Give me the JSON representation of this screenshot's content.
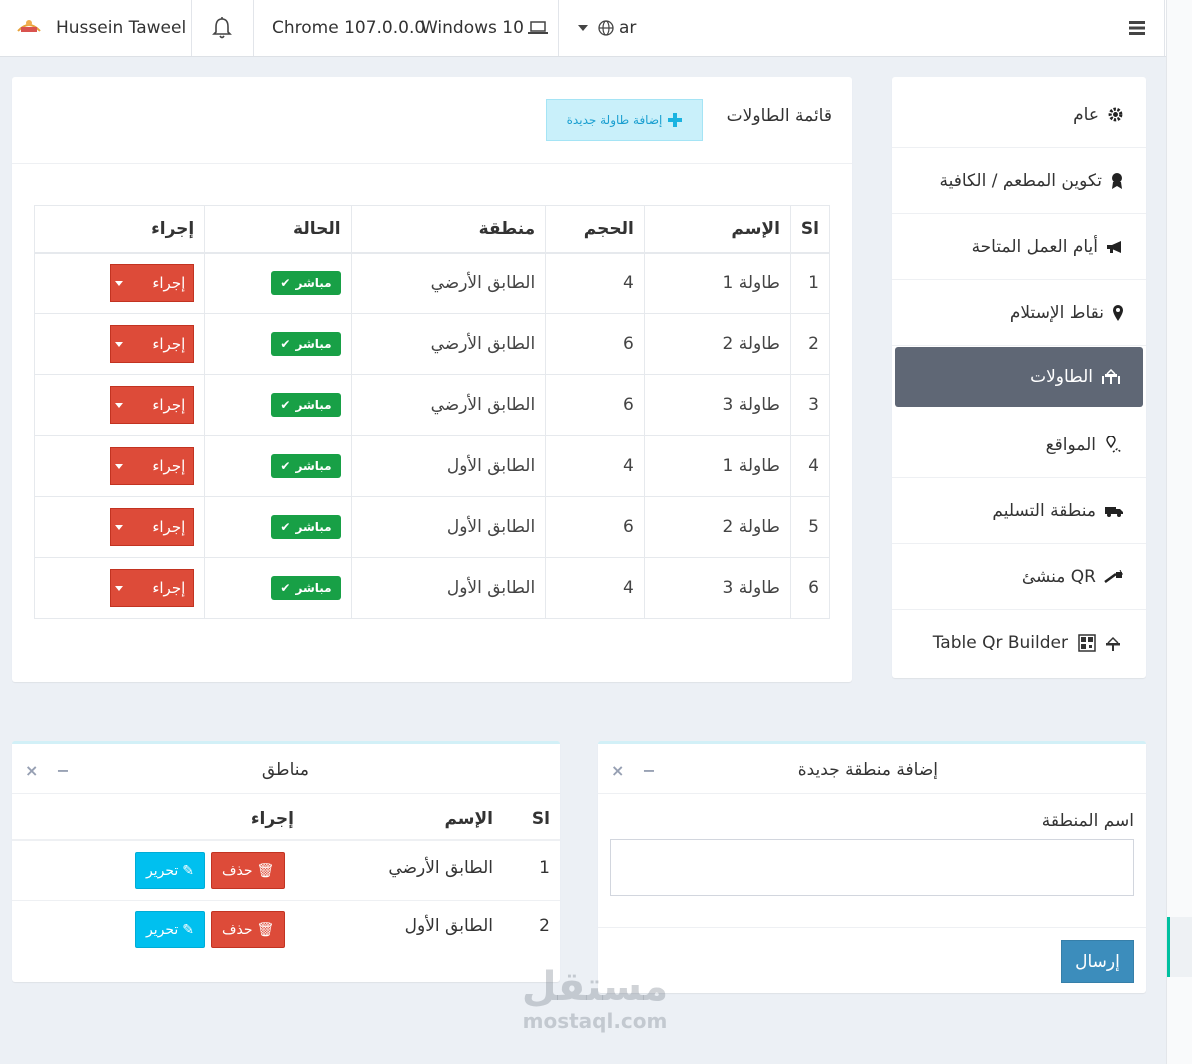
{
  "topbar": {
    "user_name": "Hussein Taweel",
    "browser": "Chrome 107.0.0.0",
    "os": "Windows 10",
    "language": "ar",
    "icons": [
      "bell-icon",
      "laptop-icon",
      "globe-icon",
      "hamburger-icon"
    ]
  },
  "settings_menu": {
    "items": [
      {
        "label": "عام",
        "icon": "gear-icon"
      },
      {
        "label": "تكوين المطعم / الكافية",
        "icon": "award-icon"
      },
      {
        "label": "أيام العمل المتاحة",
        "icon": "megaphone-icon"
      },
      {
        "label": "نقاط الإستلام",
        "icon": "map-marker-icon"
      },
      {
        "label": "الطاولات",
        "icon": "table-chairs-icon",
        "active": true
      },
      {
        "label": "المواقع",
        "icon": "location-pin-icon"
      },
      {
        "label": "منطقة التسليم",
        "icon": "truck-icon"
      },
      {
        "label": "منشئ QR",
        "icon": "qr-wand-icon"
      },
      {
        "label": "Table Qr Builder",
        "icon": "qr-table-icon"
      }
    ]
  },
  "tables_card": {
    "title": "قائمة الطاولات",
    "add_button": "إضافة طاولة جديدة",
    "headers": {
      "sl": "Sl",
      "name": "الإسم",
      "size": "الحجم",
      "area": "منطقة",
      "status": "الحالة",
      "action": "إجراء"
    },
    "rows": [
      {
        "sl": "1",
        "name": "طاولة 1",
        "size": "4",
        "area": "الطابق الأرضي",
        "status": "مباشر",
        "action": "إجراء"
      },
      {
        "sl": "2",
        "name": "طاولة 2",
        "size": "6",
        "area": "الطابق الأرضي",
        "status": "مباشر",
        "action": "إجراء"
      },
      {
        "sl": "3",
        "name": "طاولة 3",
        "size": "6",
        "area": "الطابق الأرضي",
        "status": "مباشر",
        "action": "إجراء"
      },
      {
        "sl": "4",
        "name": "طاولة 1",
        "size": "4",
        "area": "الطابق الأول",
        "status": "مباشر",
        "action": "إجراء"
      },
      {
        "sl": "5",
        "name": "طاولة 2",
        "size": "6",
        "area": "الطابق الأول",
        "status": "مباشر",
        "action": "إجراء"
      },
      {
        "sl": "6",
        "name": "طاولة 3",
        "size": "4",
        "area": "الطابق الأول",
        "status": "مباشر",
        "action": "إجراء"
      }
    ]
  },
  "add_area_card": {
    "title": "إضافة منطقة جديدة",
    "field_label": "اسم المنطقة",
    "field_value": "",
    "submit": "إرسال"
  },
  "areas_card": {
    "title": "مناطق",
    "headers": {
      "sl": "Sl",
      "name": "الإسم",
      "action": "إجراء"
    },
    "rows": [
      {
        "sl": "1",
        "name": "الطابق الأرضي",
        "delete": "حذف",
        "edit": "تحرير"
      },
      {
        "sl": "2",
        "name": "الطابق الأول",
        "delete": "حذف",
        "edit": "تحرير"
      }
    ]
  },
  "watermark": {
    "arabic": "مستقل",
    "latin": "mostaql.com"
  },
  "colors": {
    "danger": "#dd4b39",
    "success": "#18a046",
    "info": "#00c0ef",
    "primary": "#3c8dbc",
    "menu_active": "#5f6775"
  }
}
